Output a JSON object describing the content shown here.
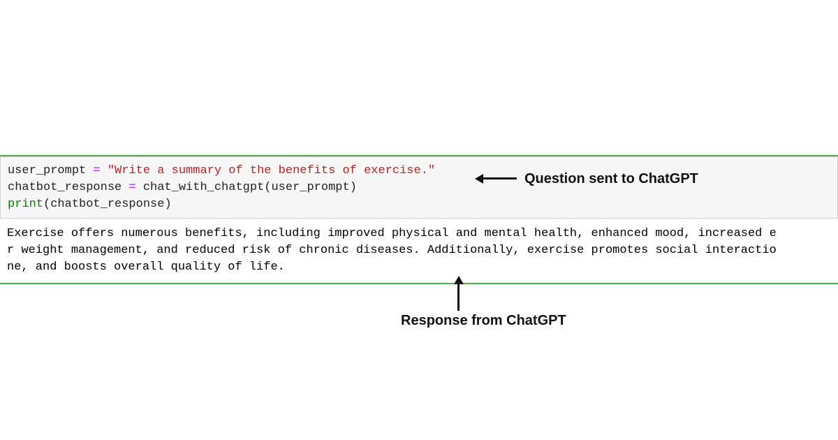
{
  "code": {
    "line1_var": "user_prompt",
    "line1_op": " = ",
    "line1_str": "\"Write a summary of the benefits of exercise.\"",
    "line2_var": "chatbot_response",
    "line2_op": " = ",
    "line2_call": "chat_with_chatgpt(user_prompt)",
    "line3_kw": "print",
    "line3_rest": "(chatbot_response)"
  },
  "output": {
    "line1": "Exercise offers numerous benefits, including improved physical and mental health, enhanced mood, increased e",
    "line2": "r weight management, and reduced risk of chronic diseases. Additionally, exercise promotes social interactio",
    "line3": "ne, and boosts overall quality of life."
  },
  "annotations": {
    "right": "Question sent to ChatGPT",
    "bottom": "Response from ChatGPT"
  }
}
